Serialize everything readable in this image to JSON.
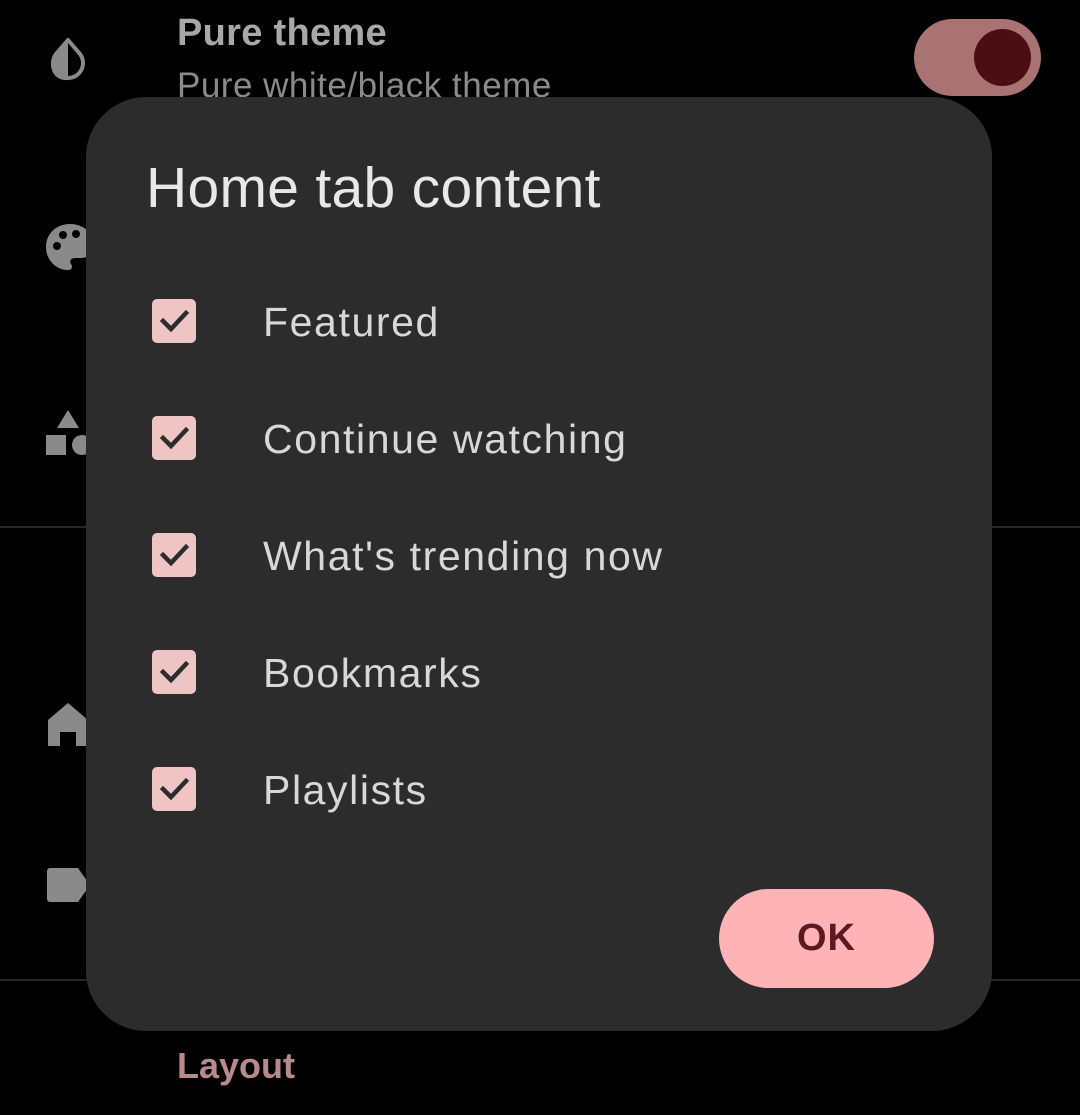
{
  "background": {
    "pure_theme": {
      "title": "Pure theme",
      "subtitle": "Pure white/black theme",
      "toggle_on": true
    },
    "section_label": "Layout",
    "icons": [
      "invert-colors-icon",
      "palette-icon",
      "category-shapes-icon",
      "home-icon",
      "label-icon"
    ]
  },
  "dialog": {
    "title": "Home tab content",
    "options": [
      {
        "label": "Featured",
        "checked": true
      },
      {
        "label": "Continue watching",
        "checked": true
      },
      {
        "label": "What's trending now",
        "checked": true
      },
      {
        "label": "Bookmarks",
        "checked": true
      },
      {
        "label": "Playlists",
        "checked": true
      }
    ],
    "ok_label": "OK"
  },
  "colors": {
    "background": "#000000",
    "dialog_surface": "#2c2c2c",
    "accent": "#ffb3b6",
    "checkbox_fill": "#eec4c4",
    "on_accent": "#5a1a1f"
  }
}
